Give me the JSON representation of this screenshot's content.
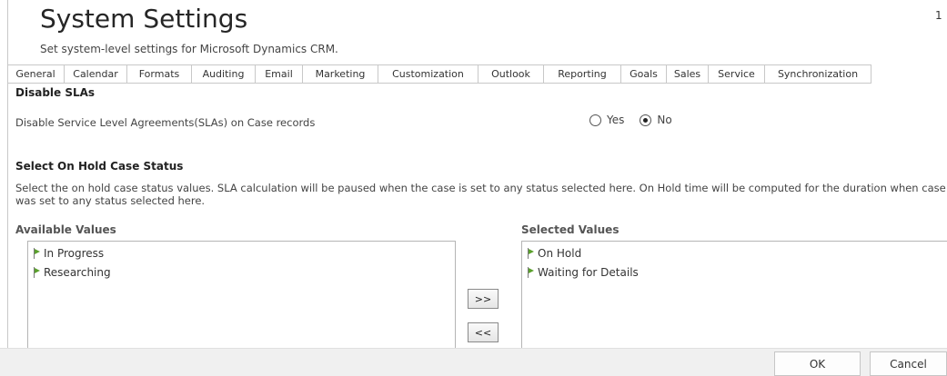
{
  "header": {
    "title": "System Settings",
    "subtitle": "Set system-level settings for Microsoft Dynamics CRM.",
    "corner_glyph": "1"
  },
  "tabs": [
    {
      "label": "General"
    },
    {
      "label": "Calendar"
    },
    {
      "label": "Formats"
    },
    {
      "label": "Auditing"
    },
    {
      "label": "Email"
    },
    {
      "label": "Marketing"
    },
    {
      "label": "Customization"
    },
    {
      "label": "Outlook"
    },
    {
      "label": "Reporting"
    },
    {
      "label": "Goals"
    },
    {
      "label": "Sales"
    },
    {
      "label": "Service",
      "active": true
    },
    {
      "label": "Synchronization"
    }
  ],
  "disable_slas": {
    "heading": "Disable SLAs",
    "question": "Disable Service Level Agreements(SLAs) on Case records",
    "yes_label": "Yes",
    "no_label": "No",
    "selected": "No"
  },
  "on_hold": {
    "heading": "Select On Hold Case Status",
    "description_line1": "Select the on hold case status values. SLA calculation will be paused when the case is set to any status selected here. On Hold time will be computed for the duration when case",
    "description_line2": "was set to any status selected here.",
    "available_heading": "Available Values",
    "selected_heading": "Selected Values",
    "available_values": [
      "In Progress",
      "Researching"
    ],
    "selected_values": [
      "On Hold",
      "Waiting for Details"
    ],
    "flag_icon": "green-flag-icon",
    "add_button": ">>",
    "remove_button": "<<"
  },
  "footer": {
    "ok_label": "OK",
    "cancel_label": "Cancel"
  }
}
